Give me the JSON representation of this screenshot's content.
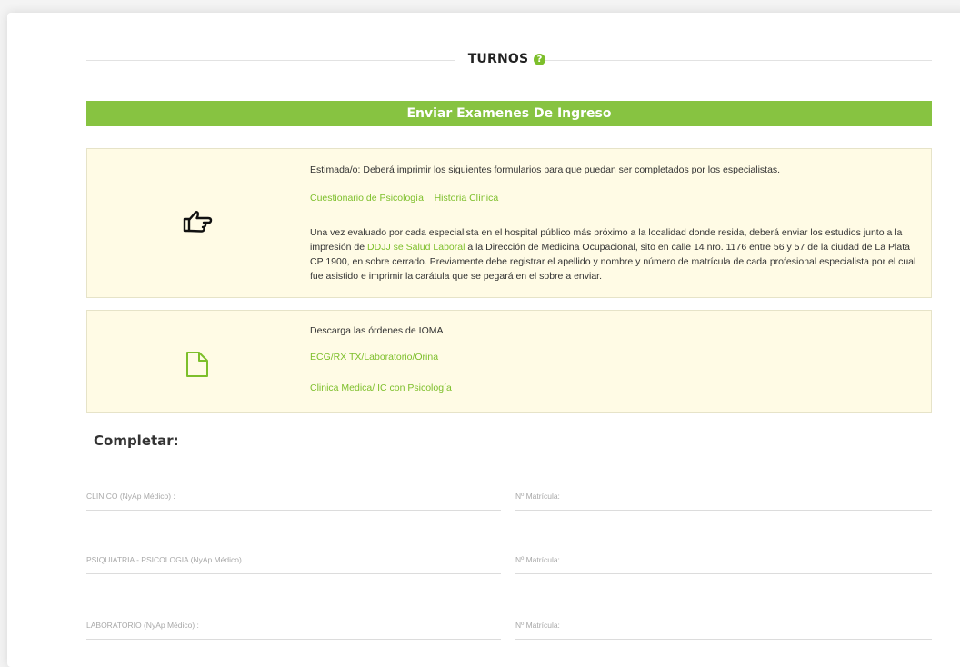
{
  "header": {
    "title": "TURNOS",
    "help_glyph": "?"
  },
  "banner": {
    "label": "Enviar Examenes De Ingreso"
  },
  "panel_forms": {
    "icon": "hand-pointing-right-icon",
    "intro": "Estimada/o: Deberá imprimir los siguientes formularios para que puedan ser completados por los especialistas.",
    "links": [
      "Cuestionario de Psicología",
      "Historia Clínica"
    ],
    "body_part1": "Una vez evaluado por cada especialista en el hospital público más próximo a la localidad donde resida, deberá enviar los estudios junto a la impresión de ",
    "body_link": "DDJJ se Salud Laboral",
    "body_part2": " a la Dirección de Medicina Ocupacional, sito en calle 14 nro. 1176 entre 56 y 57 de la ciudad de La Plata CP 1900, en sobre cerrado. Previamente debe registrar el apellido y nombre y número de matrícula de cada profesional especialista por el cual fue asistido e imprimir la carátula que se pegará en el sobre a enviar."
  },
  "panel_ioma": {
    "icon": "document-icon",
    "intro": "Descarga las órdenes de IOMA",
    "links": [
      "ECG/RX TX/Laboratorio/Orina",
      "Clinica Medica/ IC con Psicología"
    ]
  },
  "completar": {
    "title": "Completar:",
    "rows": [
      {
        "left_label": "CLINICO (NyAp Médico) :",
        "right_label": "Nº Matrícula:"
      },
      {
        "left_label": "PSIQUIATRIA - PSICOLOGIA (NyAp Médico) :",
        "right_label": "Nº Matrícula:"
      },
      {
        "left_label": "LABORATORIO (NyAp Médico) :",
        "right_label": "Nº Matrícula:"
      }
    ]
  },
  "colors": {
    "accent": "#87c341",
    "link": "#7dbf2b",
    "panel_bg": "#fffbe5"
  }
}
